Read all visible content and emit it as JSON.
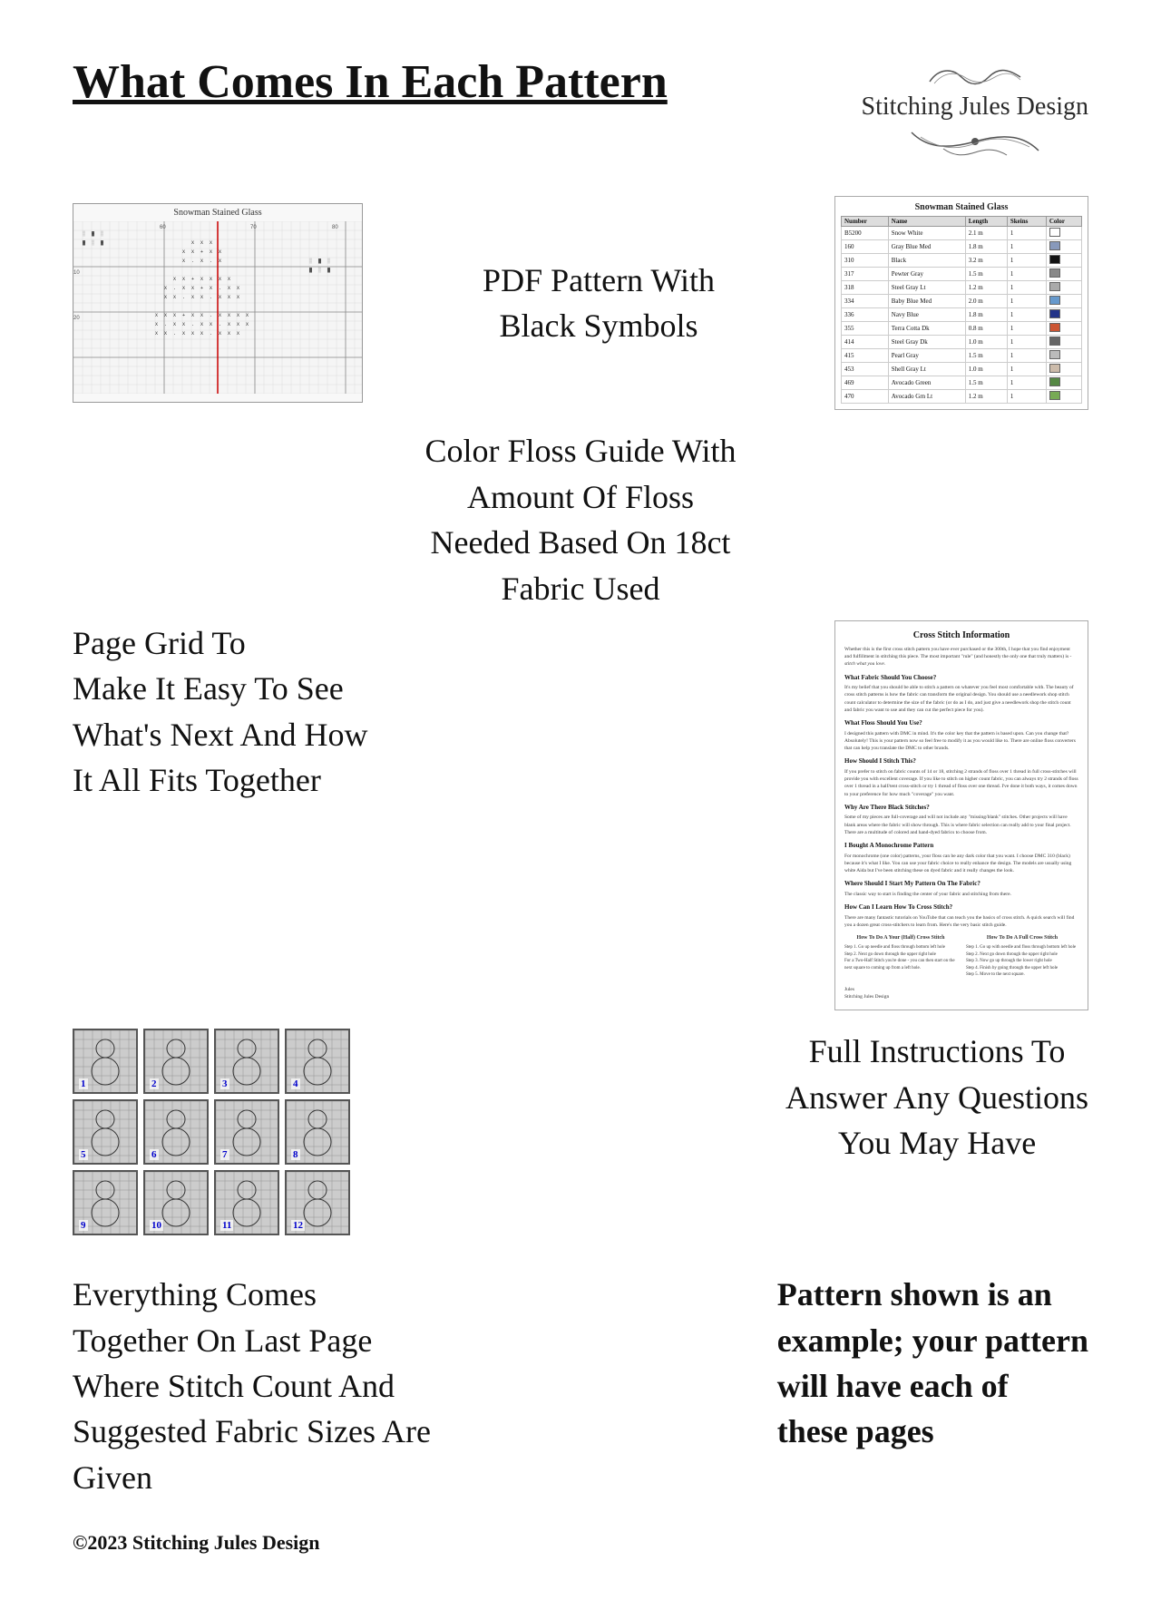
{
  "page": {
    "title": "What Comes In Each Pattern",
    "background": "#ffffff"
  },
  "brand": {
    "name": "Stitching Jules Design",
    "flourish": "~~~"
  },
  "sections": {
    "pdf_pattern": {
      "label": "PDF Pattern With\nBlack Symbols"
    },
    "floss_guide": {
      "label": "Color Floss Guide With\nAmount Of Floss\nNeeded Based On 18ct\nFabric Used"
    },
    "page_grid": {
      "label": "Page Grid To\nMake It Easy To See\nWhat’s Next And How\nIt All Fits Together"
    },
    "full_instructions": {
      "label": "Full Instructions To\nAnswer Any Questions\nYou May Have"
    },
    "everything_together": {
      "label": "Everything Comes\nTogether On Last Page\nWhere Stitch Count And\nSuggested Fabric Sizes Are\nGiven"
    },
    "pattern_note": {
      "label": "Pattern shown is an example; your pattern will have each of these pages"
    }
  },
  "pattern_image": {
    "title": "Snowman Stained Glass"
  },
  "floss_table": {
    "title": "Snowman Stained Glass",
    "headers": [
      "Number",
      "Name",
      "Length",
      "Skeins"
    ],
    "rows": [
      [
        "B5200",
        "Snow White",
        "2.1 m",
        "1",
        "#ffffff"
      ],
      [
        "160",
        "Gray Blue Med",
        "1.8 m",
        "1",
        "#8899bb"
      ],
      [
        "310",
        "Black",
        "3.2 m",
        "1",
        "#111111"
      ],
      [
        "317",
        "Pewter Gray",
        "1.5 m",
        "1",
        "#888888"
      ],
      [
        "318",
        "Steel Gray Lt",
        "1.2 m",
        "1",
        "#aaaaaa"
      ],
      [
        "334",
        "Baby Blue Med",
        "2.0 m",
        "1",
        "#6699cc"
      ],
      [
        "336",
        "Navy Blue",
        "1.8 m",
        "1",
        "#223388"
      ],
      [
        "355",
        "Terra Cotta Dk",
        "0.8 m",
        "1",
        "#cc5533"
      ],
      [
        "414",
        "Steel Gray Dk",
        "1.0 m",
        "1",
        "#666666"
      ],
      [
        "415",
        "Pearl Gray",
        "1.5 m",
        "1",
        "#bbbbbb"
      ],
      [
        "453",
        "Shell Gray Lt",
        "1.0 m",
        "1",
        "#ccbbaa"
      ],
      [
        "469",
        "Avocado Green",
        "1.5 m",
        "1",
        "#558844"
      ],
      [
        "470",
        "Avocado Grn Lt",
        "1.2 m",
        "1",
        "#77aa55"
      ]
    ]
  },
  "instructions_doc": {
    "title": "Cross Stitch Information",
    "body_text": "Whether this is the first cross stitch pattern you have ever purchased or the 300th, I hope that you find enjoyment and fulfillment in stitching this piece. The most important \"rule\" (and honestly the only one that truly matters) is - stitch what you love.",
    "sections": [
      {
        "heading": "What Fabric Should You Choose?",
        "text": "It's my belief that you should be able to stitch a pattern on whatever you feel most comfortable with. The beauty of cross stitch patterns is how the fabric can transform the original design. The models are usually stitching white Aida but I've been stitching these on dyed fabric and it really changes the look."
      },
      {
        "heading": "What Floss Should You Use?",
        "text": "I designed this pattern with DMC in mind. It's the color key that the pattern is based upon. Can you change that? Absolutely! This is your pattern now so feel free to modify it as you would like to. There are online floss converters that can help you translate the DMC to other brands."
      },
      {
        "heading": "How Should I Stitch This?",
        "text": "If you prefer to stitch on fabric counts of 14 or 18, stitching 2 strands of floss over 1 thread in full cross-stitches will provide you with excellent coverage. If you like to stitch on higher count fabric, you can always try 2 strands of floss over 1 thread in a half/tent cross-stitch or try 1 thread of floss over one thread. I've done it both ways, it comes down to your preference for how much coverage you want."
      },
      {
        "heading": "Why Are There Black Stitches?",
        "text": "Some of my pieces are full coverage and will not include any missing/blank stitches. Other projects will have blank areas where the fabric will show through. This is where fabric selection can really add to your final project. There are a multitude of colored and hand-dyed fabrics to choose from."
      },
      {
        "heading": "I Bought A Monochrome Pattern",
        "text": "For monochrome (one color) patterns, your floss can be any dark color that you want. I choose DMC 310 (black) because it's what I like. You can use your fabric choice to really enhance the design."
      },
      {
        "heading": "Where Should I Start My Pattern On The Fabric?",
        "text": "The classic way to start is finding the center of your fabric and stitching from there."
      },
      {
        "heading": "How Can I Learn How To Cross Stitch?",
        "text": "There are many fantastic tutorials on YouTube that can teach you the basics of cross stitch. A quick search will find you a dozen great cross-stitchers to learn from. Here's the very basic stitch guide."
      },
      {
        "heading": "How To Do A Your (Half) Cross Stitch",
        "col2_heading": "How To Do A Full Cross Stitch",
        "steps_col1": [
          "Step 1. Go up needle and floss through bottom left hole",
          "Step 2. Next go down through the upper right hole",
          "For a Two-Half Stitch you're done - you can then start on the next square to coming up from a left hole."
        ],
        "steps_col2": [
          "Step 1. Go up with needle and floss through bottom left hole",
          "Step 2. Next go down through the upper right hole",
          "Step 3. Now go up through the lower right hole",
          "Step 4. Finish by going through the upper left hole",
          "Step 5. Move to the next square."
        ]
      }
    ],
    "signature": "Jules\nStitching Jules Design"
  },
  "thumbnails": [
    {
      "num": "1"
    },
    {
      "num": "2"
    },
    {
      "num": "3"
    },
    {
      "num": "4"
    },
    {
      "num": "5"
    },
    {
      "num": "6"
    },
    {
      "num": "7"
    },
    {
      "num": "8"
    },
    {
      "num": "9"
    },
    {
      "num": "10"
    },
    {
      "num": "11"
    },
    {
      "num": "12"
    }
  ],
  "footer": {
    "copyright": "©2023 Stitching Jules Design"
  }
}
